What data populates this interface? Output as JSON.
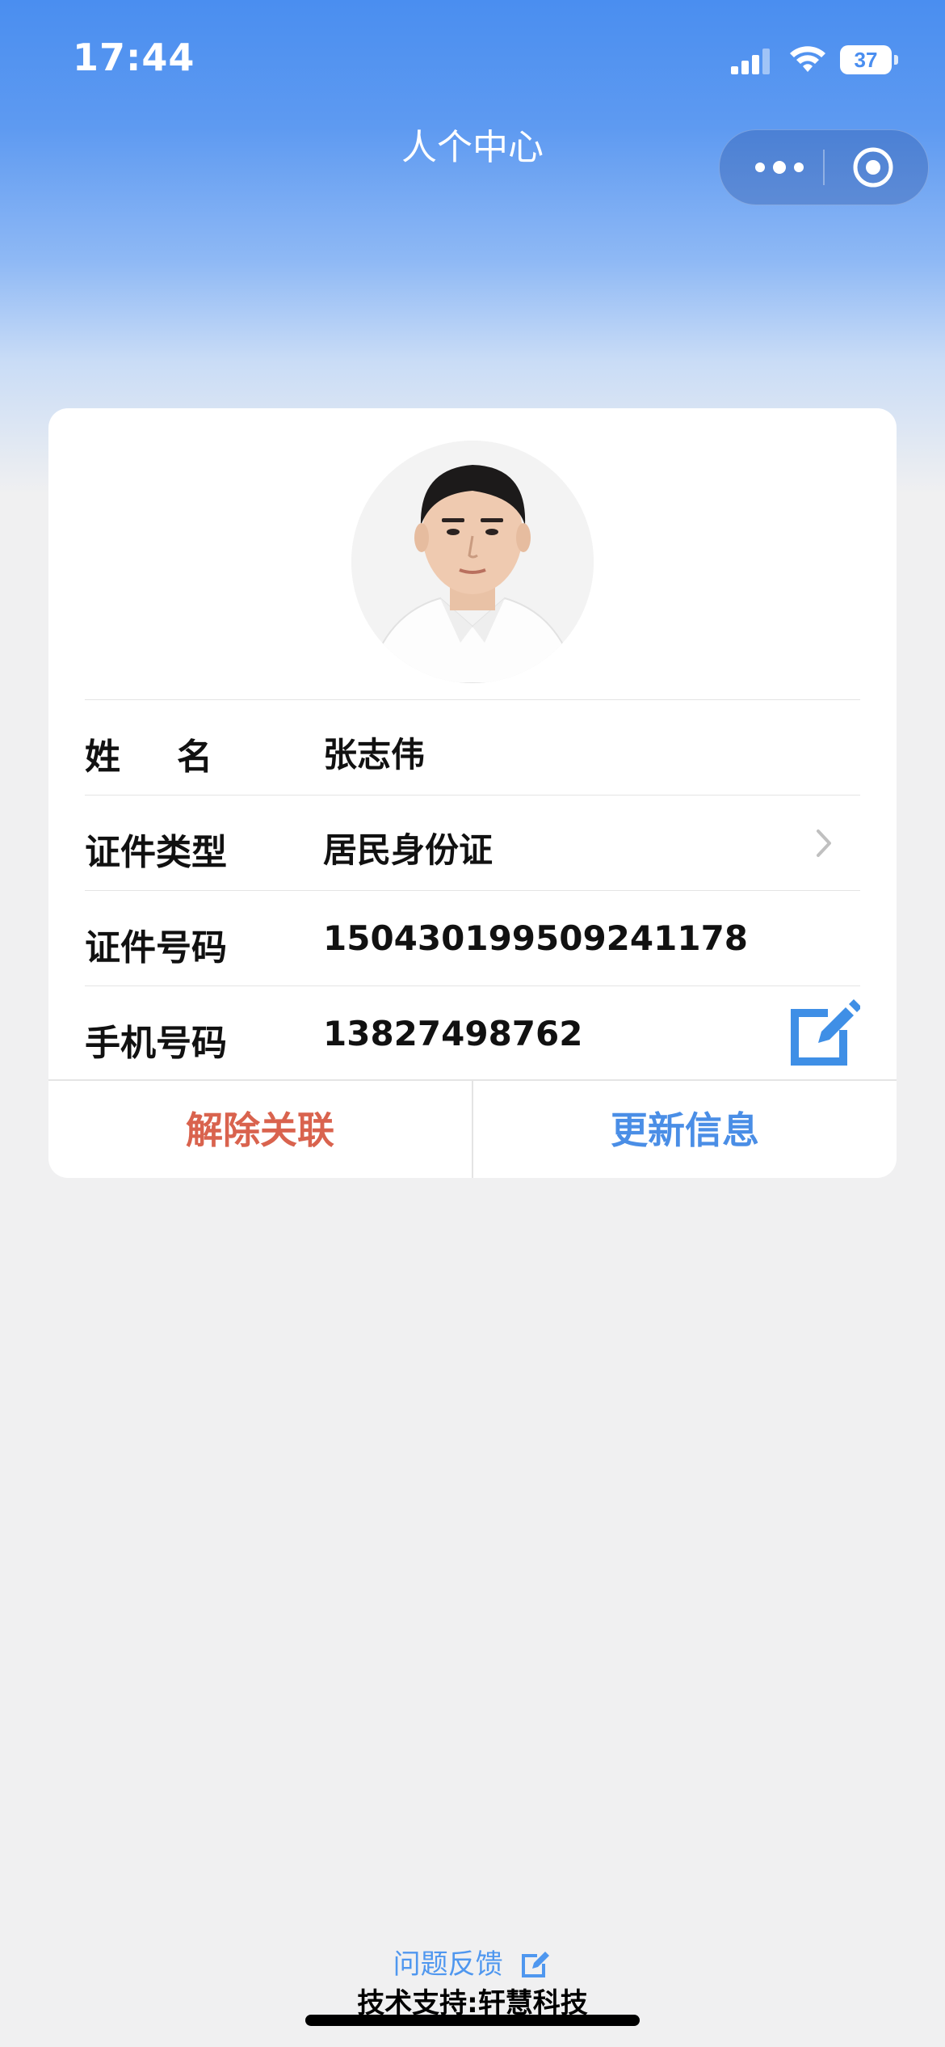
{
  "status_bar": {
    "time": "17:44",
    "battery": "37"
  },
  "nav": {
    "title": "人个中心",
    "capsule_more_icon": "more-dots-icon",
    "capsule_close_icon": "target-circle-icon"
  },
  "profile": {
    "avatar": "person-photo",
    "rows": [
      {
        "label": "姓名",
        "value": "张志伟"
      },
      {
        "label": "证件类型",
        "value": "居民身份证",
        "icon": "chevron-right-icon"
      },
      {
        "label": "证件号码",
        "value": "150430199509241178"
      },
      {
        "label": "手机号码",
        "value": "13827498762",
        "icon": "edit-icon"
      }
    ],
    "actions": {
      "unbind": "解除关联",
      "update": "更新信息"
    }
  },
  "footer": {
    "feedback": "问题反馈",
    "support": "技术支持:轩慧科技"
  },
  "colors": {
    "primary": "#4a8ee6",
    "danger": "#d9634e",
    "background": "#f0f0f1"
  }
}
